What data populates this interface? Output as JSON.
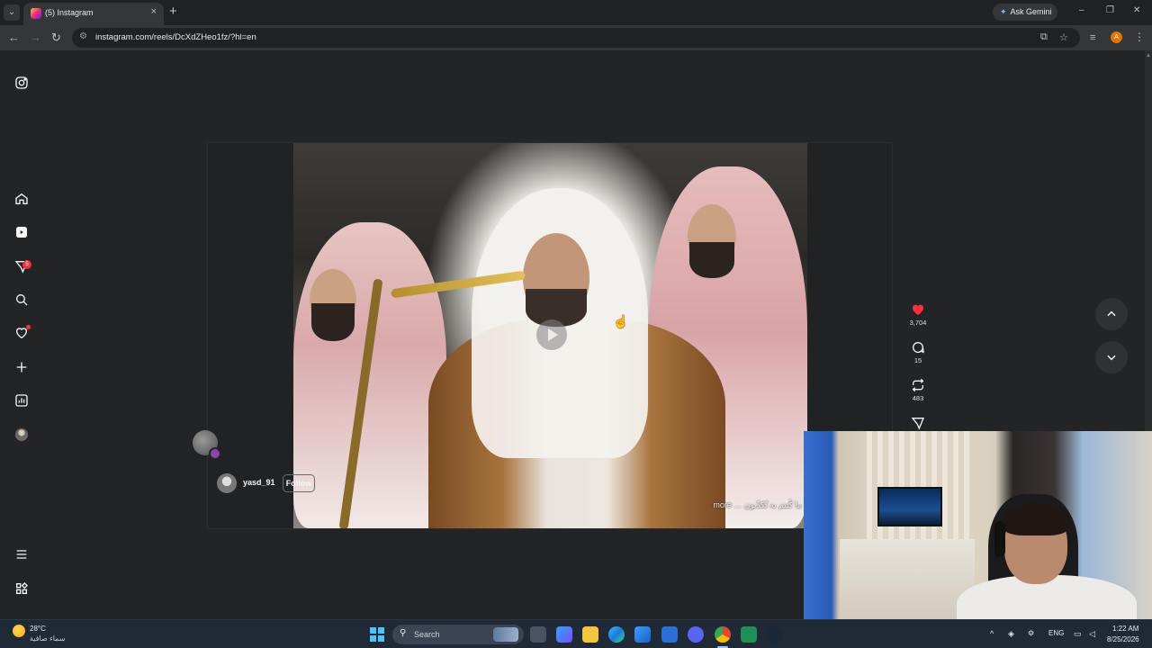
{
  "browser": {
    "tab_title": "(5) Instagram",
    "tab_close": "×",
    "new_tab": "+",
    "gemini_label": "Ask Gemini",
    "url": "instagram.com/reels/DcXdZHeo1fz/?hl=en",
    "profile_initial": "A",
    "window_controls": [
      "–",
      "❐",
      "✕"
    ]
  },
  "sidebar": {
    "items": [
      {
        "name": "instagram-logo-icon"
      },
      {
        "name": "home-icon"
      },
      {
        "name": "reels-icon"
      },
      {
        "name": "direct-messages-icon",
        "badge": "5"
      },
      {
        "name": "search-icon"
      },
      {
        "name": "notifications-icon"
      },
      {
        "name": "create-icon"
      },
      {
        "name": "dashboard-icon"
      },
      {
        "name": "profile-avatar"
      },
      {
        "name": "menu-icon"
      },
      {
        "name": "also-from-meta-icon"
      }
    ]
  },
  "reel": {
    "username": "yasd_91",
    "follow_label": "Follow",
    "caption": "more … ما كُنتم به تُكذّبون",
    "likes": "3,704",
    "comments": "15",
    "reposts": "483",
    "accent_like": "#ff3040"
  },
  "taskbar": {
    "weather_temp": "28°C",
    "weather_desc": "سماء صافية",
    "search_label": "Search",
    "language": "ENG",
    "time": "1:22 AM",
    "date": "8/25/2026"
  }
}
